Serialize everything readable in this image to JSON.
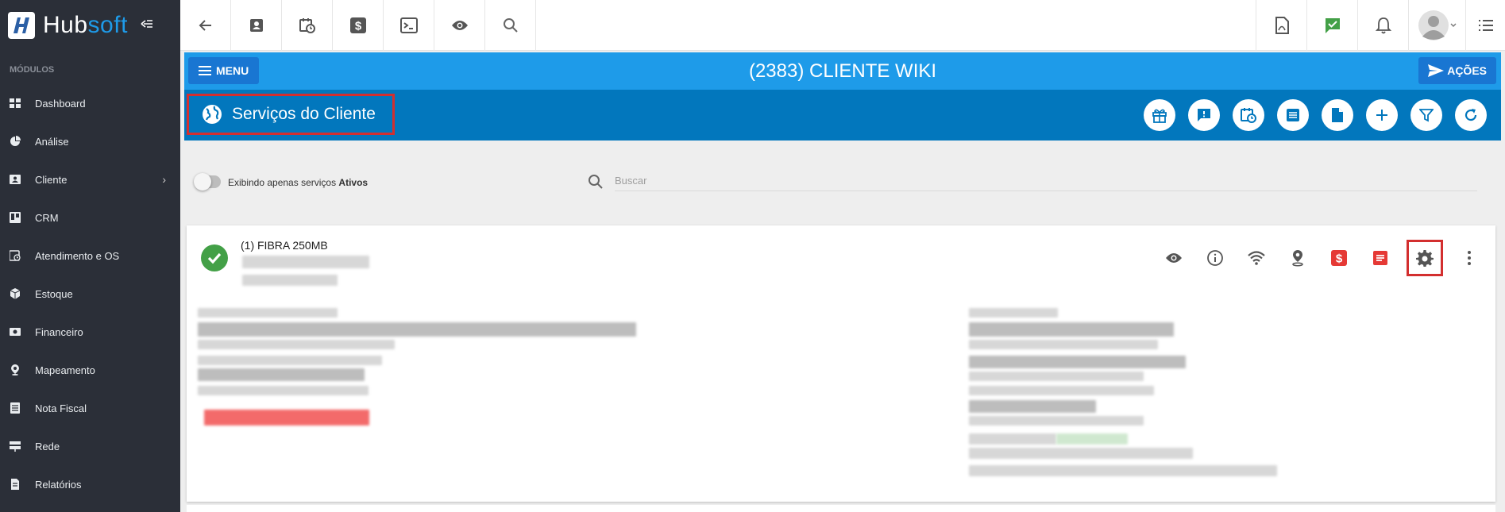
{
  "brand": {
    "hub": "Hub",
    "soft": "soft"
  },
  "sidebar": {
    "section_title": "MÓDULOS",
    "items": [
      {
        "label": "Dashboard",
        "icon": "dashboard-icon"
      },
      {
        "label": "Análise",
        "icon": "pie-chart-icon"
      },
      {
        "label": "Cliente",
        "icon": "contact-card-icon",
        "has_submenu": true
      },
      {
        "label": "CRM",
        "icon": "kanban-icon"
      },
      {
        "label": "Atendimento e OS",
        "icon": "calendar-clock-icon"
      },
      {
        "label": "Estoque",
        "icon": "box-icon"
      },
      {
        "label": "Financeiro",
        "icon": "money-icon"
      },
      {
        "label": "Mapeamento",
        "icon": "map-pin-icon"
      },
      {
        "label": "Nota Fiscal",
        "icon": "invoice-icon"
      },
      {
        "label": "Rede",
        "icon": "network-icon"
      },
      {
        "label": "Relatórios",
        "icon": "report-icon"
      }
    ]
  },
  "header": {
    "menu_label": "MENU",
    "client_title": "(2383) CLIENTE WIKI",
    "acoes_label": "AÇÕES"
  },
  "subheader": {
    "title": "Serviços do Cliente"
  },
  "filter": {
    "toggle_label_prefix": "Exibindo apenas serviços ",
    "toggle_label_bold": "Ativos",
    "search_placeholder": "Buscar"
  },
  "service": {
    "name": "(1) FIBRA 250MB",
    "status": "active"
  },
  "colors": {
    "sidebar_bg": "#2b2f38",
    "header_blue": "#1e9be9",
    "subheader_blue": "#0277bd",
    "button_blue": "#1976d2",
    "highlight_red": "#d32f2f",
    "status_green": "#43a047"
  }
}
